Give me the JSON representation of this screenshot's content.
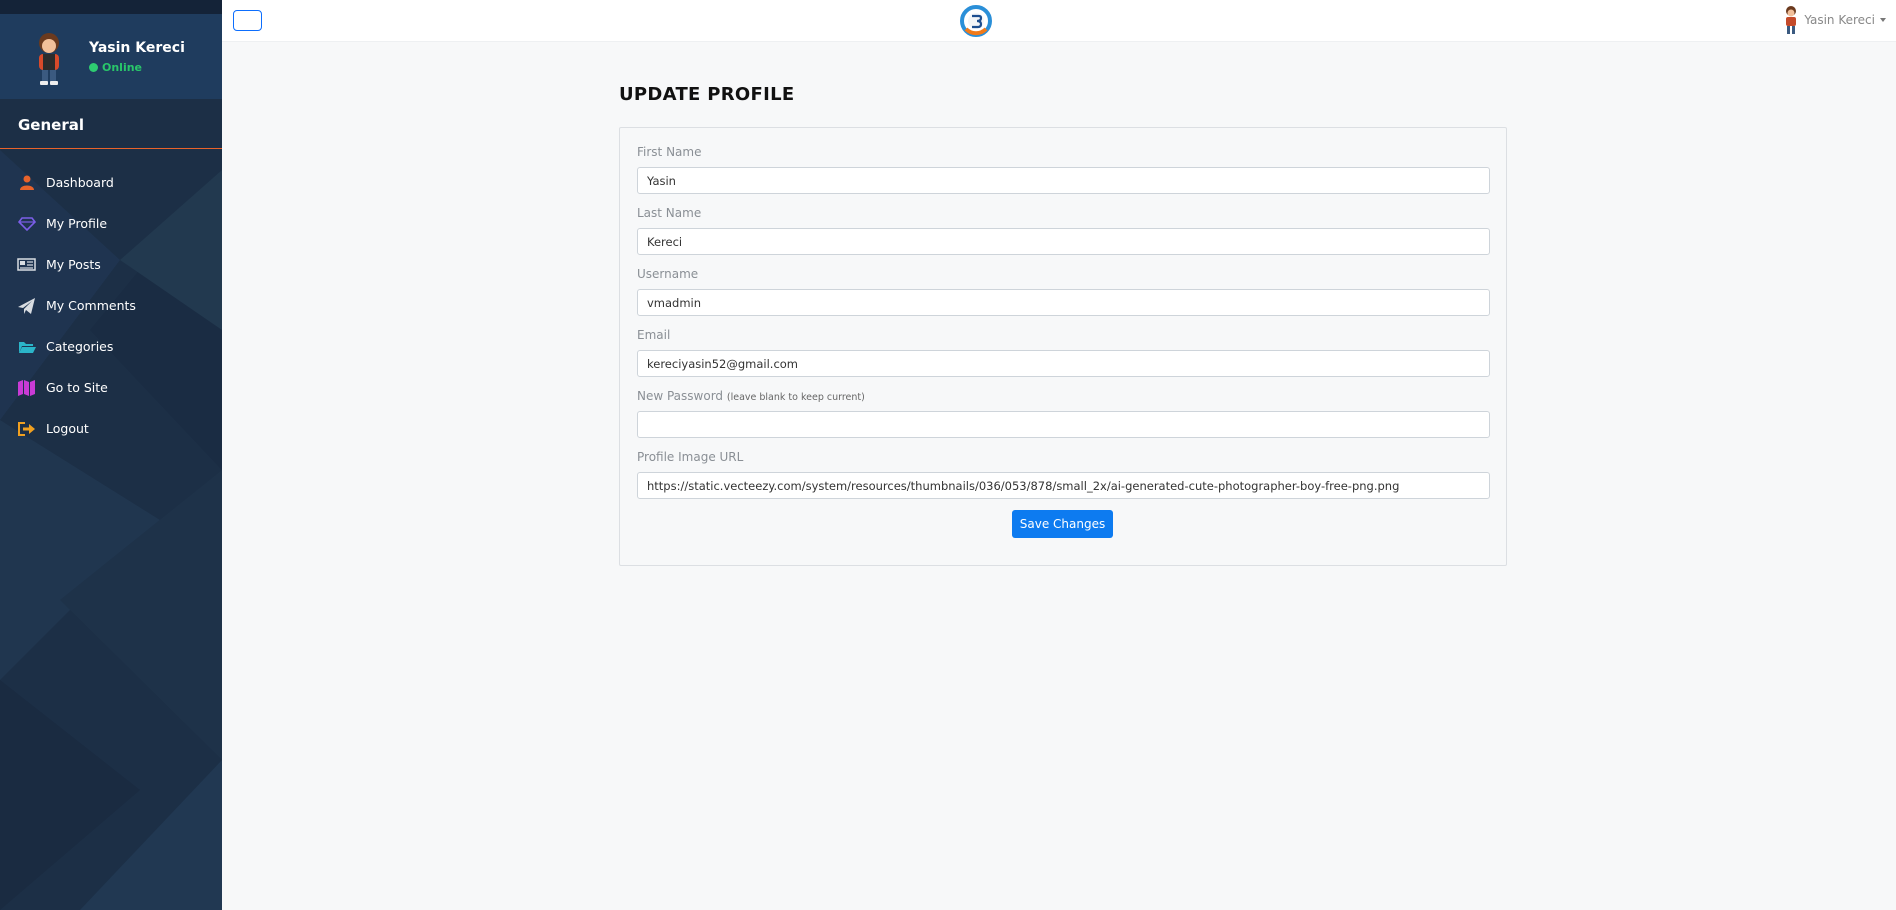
{
  "sidebar": {
    "user_name": "Yasin Kereci",
    "status": "Online",
    "section_title": "General",
    "items": [
      {
        "label": "Dashboard",
        "icon": "user-icon",
        "color": "#e8632b"
      },
      {
        "label": "My Profile",
        "icon": "diamond-icon",
        "color": "#7b5ee8"
      },
      {
        "label": "My Posts",
        "icon": "newspaper-icon",
        "color": "#d9dde2"
      },
      {
        "label": "My Comments",
        "icon": "paper-plane-icon",
        "color": "#d9dde2"
      },
      {
        "label": "Categories",
        "icon": "folder-open-icon",
        "color": "#2bb5c9"
      },
      {
        "label": "Go to Site",
        "icon": "map-icon",
        "color": "#c93bd6"
      },
      {
        "label": "Logout",
        "icon": "sign-out-icon",
        "color": "#f0a020"
      }
    ]
  },
  "topbar": {
    "user_name": "Yasin Kereci",
    "logo_icon": "site-logo-icon"
  },
  "main": {
    "title": "UPDATE PROFILE",
    "fields": {
      "first_name": {
        "label": "First Name",
        "value": "Yasin"
      },
      "last_name": {
        "label": "Last Name",
        "value": "Kereci"
      },
      "username": {
        "label": "Username",
        "value": "vmadmin"
      },
      "email": {
        "label": "Email",
        "value": "kereciyasin52@gmail.com"
      },
      "password": {
        "label": "New Password",
        "hint": "(leave blank to keep current)",
        "value": ""
      },
      "profile_image": {
        "label": "Profile Image URL",
        "value": "https://static.vecteezy.com/system/resources/thumbnails/036/053/878/small_2x/ai-generated-cute-photographer-boy-free-png.png"
      }
    },
    "save_label": "Save Changes"
  },
  "colors": {
    "sidebar_bg": "#1c2f46",
    "profile_bg": "#1f3c5e",
    "accent_rule": "#e8632b",
    "primary": "#0d7bf0",
    "online": "#2ecc71"
  }
}
